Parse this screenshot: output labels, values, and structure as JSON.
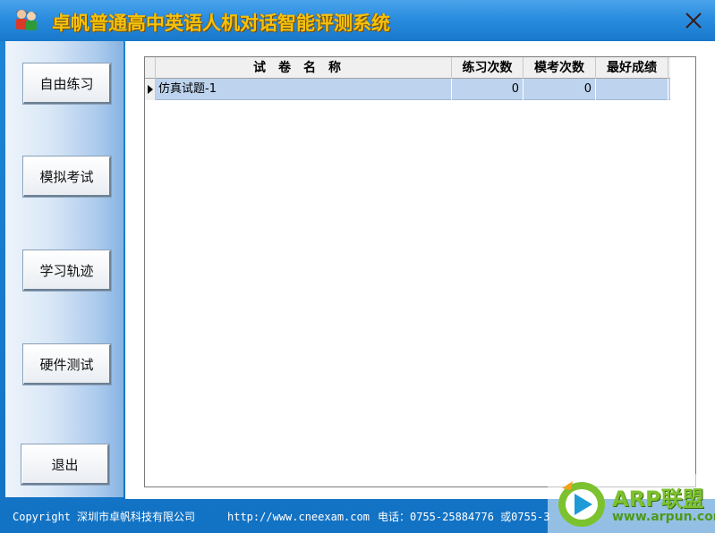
{
  "window": {
    "title": "卓帆普通高中英语人机对话智能评测系统",
    "accent_color": "#1878cb",
    "title_color": "#f4c20d"
  },
  "sidebar": {
    "buttons": [
      {
        "label": "自由练习"
      },
      {
        "label": "模拟考试"
      },
      {
        "label": "学习轨迹"
      },
      {
        "label": "硬件测试"
      },
      {
        "label": "退出"
      }
    ]
  },
  "grid": {
    "columns": [
      "试卷名称",
      "练习次数",
      "模考次数",
      "最好成绩"
    ],
    "rows": [
      {
        "name": "仿真试题-1",
        "practice_count": "0",
        "mock_count": "0",
        "best_score": ""
      }
    ],
    "selected_row_color": "#bdd3ee"
  },
  "footer": {
    "copyright": "Copyright",
    "company": "深圳市卓帆科技有限公司",
    "url": "http://www.cneexam.com",
    "phone": "电话：0755-25884776 或0755-3"
  },
  "watermark": {
    "brand": "ARP联盟",
    "url": "www.arpun.com"
  },
  "icons": [
    "app-users-icon",
    "close-icon",
    "row-pointer-icon",
    "arp-play-logo-icon"
  ]
}
